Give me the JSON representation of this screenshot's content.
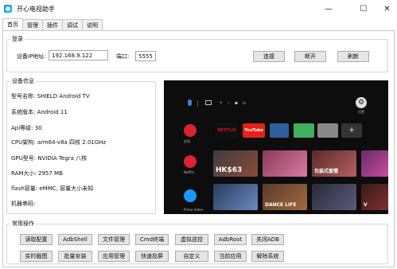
{
  "window": {
    "title": "开心电视助手",
    "minimize": "—",
    "maximize": "☐",
    "close": "✕"
  },
  "tabs": [
    "首页",
    "管理",
    "插件",
    "调试",
    "说明"
  ],
  "login": {
    "legend": "登录",
    "ip_label": "设备IP地址:",
    "ip_value": "192.168.9.122",
    "port_label": "端口:",
    "port_value": "5555",
    "connect": "连接",
    "disconnect": "断开",
    "refresh": "刷新"
  },
  "device_info": {
    "legend": "设备信息",
    "rows": [
      {
        "label": "型号名称:",
        "value": "SHIELD Android TV"
      },
      {
        "label": "系统版本:",
        "value": "Android 11"
      },
      {
        "label": "Api等级:",
        "value": "30"
      },
      {
        "label": "CPU架构:",
        "value": "arm64-v8a 四核 2.01GHz"
      },
      {
        "label": "GPU型号:",
        "value": "NVIDIA Tegra 八核"
      },
      {
        "label": "RAM大小:",
        "value": "2957 MB"
      },
      {
        "label": "flash容量:",
        "value": "eMMC, 容量大小未知"
      },
      {
        "label": "机器串码:",
        "value": ""
      }
    ]
  },
  "tv_screen": {
    "gear_label": "设置",
    "apps_label": "应用",
    "netflix_side_label": "Netflix",
    "prime_label": "Prime Video",
    "tiles": [
      "NETFLIX",
      "YouTube",
      "",
      "",
      "",
      "+"
    ],
    "posters": [
      "",
      "HK$63",
      "",
      "包装式爱情",
      "",
      "",
      "DANCE LIFE",
      "",
      "V"
    ]
  },
  "operations": {
    "legend": "常用操作",
    "row1": [
      "读取配置",
      "AdbShell",
      "文件管理",
      "Cmd终端",
      "虚拟遥控",
      "AdbRoot",
      "关闭ADB"
    ],
    "row2": [
      "实时截图",
      "批量安装",
      "应用管理",
      "快速投屏",
      "自定义",
      "当前应用",
      "解除系统"
    ]
  }
}
